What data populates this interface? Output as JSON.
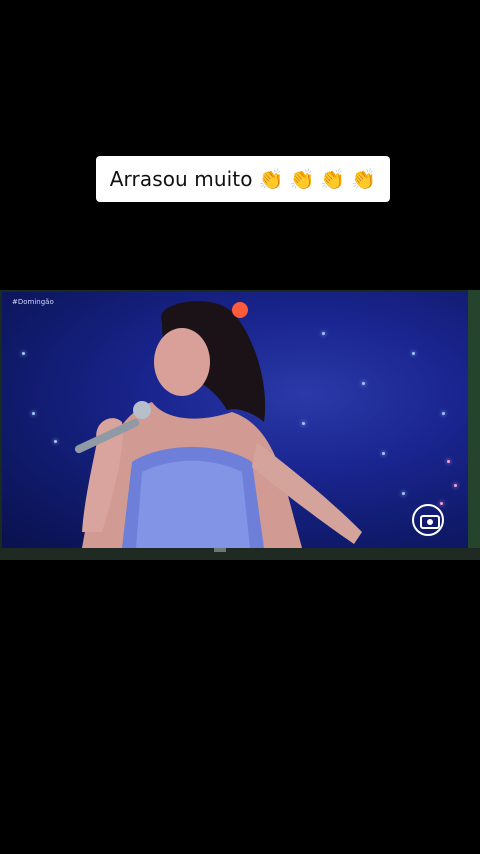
{
  "caption": {
    "text": "Arrasou muito",
    "emojis": [
      "👏",
      "👏",
      "👏",
      "👏"
    ]
  },
  "tv": {
    "channel_tag": "#Domingão",
    "logo": "globo-logo-icon"
  }
}
